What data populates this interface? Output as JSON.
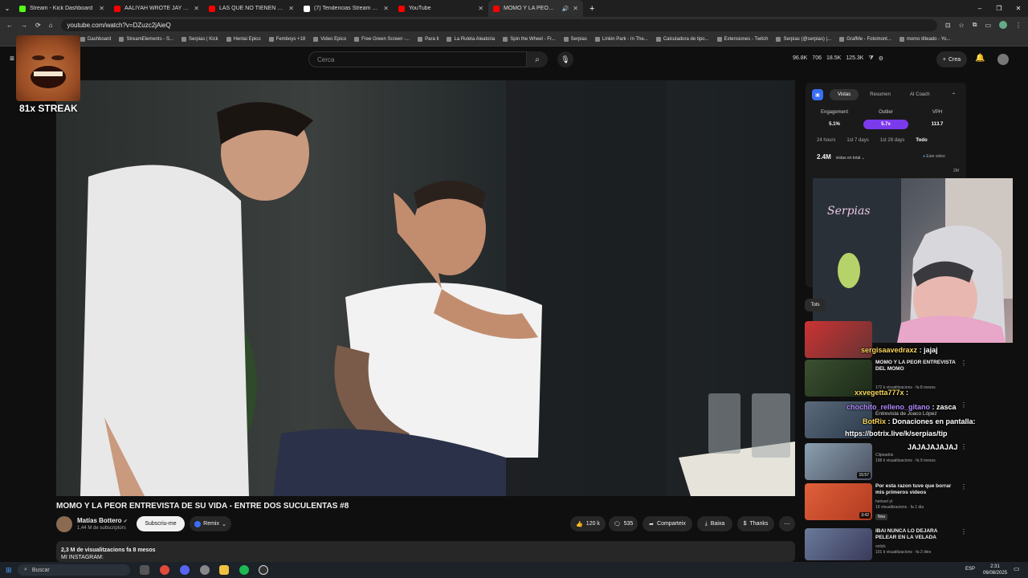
{
  "browser": {
    "tabs": [
      {
        "label": "Stream - Kick Dashboard",
        "color": "#53fc18",
        "active": false
      },
      {
        "label": "AALIYAH WROTE JAY AN APOL",
        "color": "#ff0000",
        "active": false
      },
      {
        "label": "LAS QUE NO TIENEN PAPÁ - D",
        "color": "#ff0000",
        "active": false
      },
      {
        "label": "(7) Tendencias Stream en X:",
        "color": "#ffffff",
        "active": false
      },
      {
        "label": "YouTube",
        "color": "#ff0000",
        "active": false
      },
      {
        "label": "MOMO Y LA PEOR ENTREVI",
        "color": "#ff0000",
        "active": true
      }
    ],
    "url": "youtube.com/watch?v=DZuzc2jAieQ",
    "bookmarks": [
      "Dashboard",
      "StreamElements - S...",
      "Serpias | Kick",
      "Hentai Epico",
      "Femboys +18",
      "Video Epico",
      "Free Green Screen -...",
      "Para ti",
      "La Ruleta Aleatoria",
      "Spin the Wheel - Fr...",
      "Serpias",
      "Linkin Park - In The...",
      "Calculadora de tipo...",
      "Extensiones - Twitch",
      "Serpias (@serpias) |...",
      "GrafMe - Fotomont...",
      "momo tilteado - Yo..."
    ]
  },
  "overlay": {
    "streak": "81x STREAK"
  },
  "youtube": {
    "search_placeholder": "Cerca",
    "header_stats": [
      "96.8K",
      "706",
      "18.5K",
      "125.3K"
    ],
    "create_label": "Crea",
    "video_title": "MOMO Y LA PEOR ENTREVISTA DE SU VIDA - ENTRE DOS SUCULENTAS #8",
    "channel_name": "Matías Bottero",
    "channel_subs": "1,44 M de subscriptors",
    "subscribe_label": "Subscriu-me",
    "remix_label": "Remix",
    "likes": "120 k",
    "comments": "535",
    "share_label": "Comparteix",
    "download_label": "Baixa",
    "thanks_label": "Thanks",
    "desc_meta": "2,3 M de visualitzacions  fa 8 mesos",
    "desc_line": "MI INSTAGRAM:"
  },
  "analytics": {
    "tabs": [
      "Vistas",
      "Resumen",
      "AI Coach"
    ],
    "metrics": [
      {
        "label": "Engagement",
        "value": "5.1%"
      },
      {
        "label": "Outlier",
        "value": "5.7x"
      },
      {
        "label": "VPH",
        "value": "113.7"
      }
    ],
    "ranges": [
      "24 hours",
      "1st 7 days",
      "1st 28 days",
      "Todo"
    ],
    "total": "2.4M",
    "total_label": "vistas en total",
    "legend": "Este video",
    "y_tick_top": "2M",
    "y_tick_zero": "0"
  },
  "sidebar": {
    "chip": "Tots",
    "recommendations": [
      {
        "title": "",
        "meta": "",
        "duration": ""
      },
      {
        "title": "MOMO Y LA PEOR ENTREVISTA DEL MOMO",
        "meta": "172 k visualitzacions · fa 8 mesos",
        "duration": ""
      },
      {
        "title": "Entrevista de Joaco López",
        "meta": "",
        "duration": ""
      },
      {
        "title": "",
        "meta": "Clipeados\n198 k visualitzacions · fa 9 mesos",
        "duration": "15:57"
      },
      {
        "title": "Por esta razon tuve que borrar mis primeros videos",
        "meta": "heinsel yt\n19 visualitzacions · fa 1 dia",
        "badge": "Nou",
        "duration": "3:42"
      },
      {
        "title": "IBAI NUNCA LO DEJARA PELEAR EN LA VELADA",
        "meta": "onlick\n101 k visualitzacions · fa 2 dies",
        "duration": ""
      }
    ]
  },
  "chat": [
    {
      "user": "sergisaavedraxz",
      "message": "jajaj",
      "user_color": "#f8d45a"
    },
    {
      "user": "xxvegetta777x",
      "message": "",
      "user_color": "#f8d45a"
    },
    {
      "user": "chochito_relleno_gitano",
      "message": "zasca",
      "user_color": "#b088ff"
    },
    {
      "user": "BotRix",
      "message": "Donaciones en pantalla:",
      "user_color": "#f8d45a"
    },
    {
      "user": "",
      "message": "https://botrix.live/k/serpias/tip",
      "user_color": "#ffffff"
    },
    {
      "user": "",
      "message": "JAJAJAJAJAJ",
      "user_color": "#ffffff"
    }
  ],
  "taskbar": {
    "search_label": "Buscar",
    "lang": "ESP",
    "time": "2:31",
    "date": "06/08/2025"
  }
}
